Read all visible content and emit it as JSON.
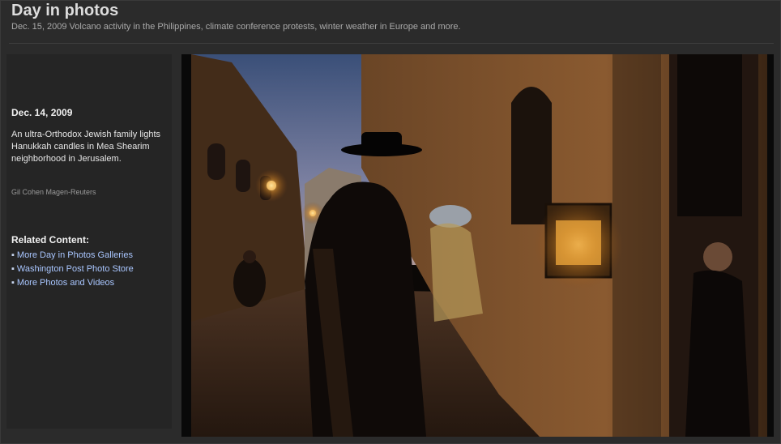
{
  "header": {
    "title": "Day in photos",
    "subtitle": "Dec. 15, 2009 Volcano activity in the Philippines, climate conference protests, winter weather in Europe and more."
  },
  "sidebar": {
    "date": "Dec. 14, 2009",
    "caption": "An ultra-Orthodox Jewish family lights Hanukkah candles in Mea Shearim neighborhood in Jerusalem.",
    "credit": "Gil Cohen Magen-Reuters",
    "related_heading": "Related Content:",
    "related_links": [
      "More Day in Photos Galleries",
      "Washington Post Photo Store",
      "More Photos and Videos"
    ]
  },
  "colors": {
    "background": "#2b2b2b",
    "link": "#a9c6ff",
    "title": "#dcdcdc"
  }
}
